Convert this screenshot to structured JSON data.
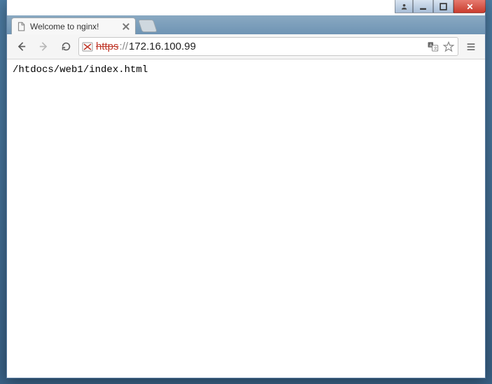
{
  "tab": {
    "title": "Welcome to nginx!"
  },
  "address": {
    "scheme": "https",
    "scheme_struck": true,
    "separator": "://",
    "host": "172.16.100.99"
  },
  "page": {
    "body_text": "/htdocs/web1/index.html"
  },
  "icons": {
    "translate": "translate-icon",
    "star": "star-icon",
    "menu": "menu-icon"
  }
}
